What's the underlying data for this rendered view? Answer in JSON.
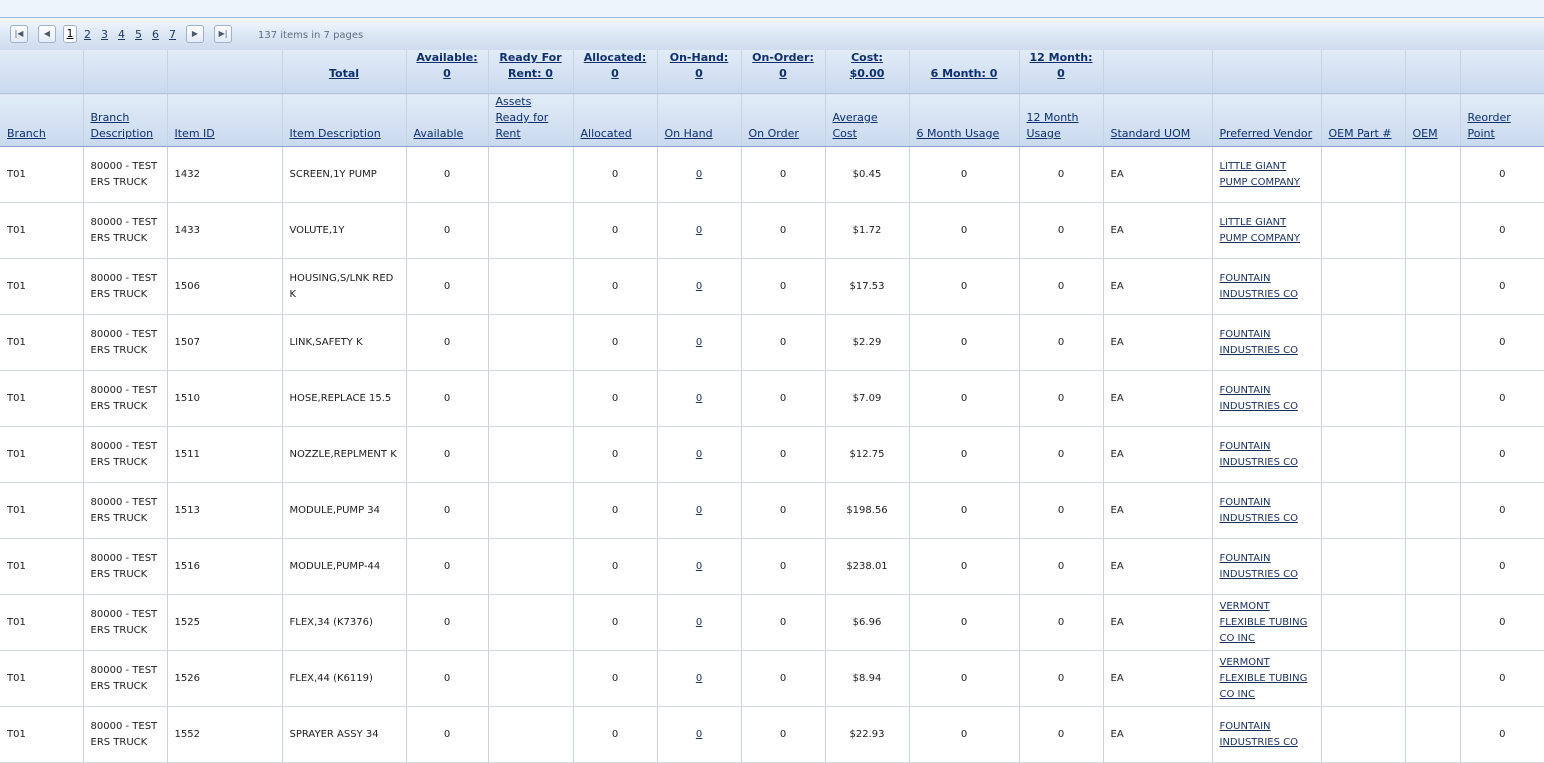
{
  "pager": {
    "first_icon": "first-page-icon",
    "prev_icon": "prev-page-icon",
    "next_icon": "next-page-icon",
    "last_icon": "last-page-icon",
    "pages": [
      "1",
      "2",
      "3",
      "4",
      "5",
      "6",
      "7"
    ],
    "current_page": "1",
    "info": "137 items in 7 pages"
  },
  "aggregates": {
    "total": "Total",
    "available": "Available: 0",
    "ready_for_rent": "Ready For Rent: 0",
    "allocated": "Allocated: 0",
    "on_hand": "On-Hand: 0",
    "on_order": "On-Order: 0",
    "cost": "Cost: $0.00",
    "six_month": "6 Month: 0",
    "twelve_month": "12 Month: 0"
  },
  "columns": {
    "branch": "Branch",
    "branch_description": "Branch Description",
    "item_id": "Item ID",
    "item_description": "Item Description",
    "available": "Available",
    "assets_ready": "Assets Ready for Rent",
    "allocated": "Allocated",
    "on_hand": "On Hand",
    "on_order": "On Order",
    "average_cost": "Average Cost",
    "six_month_usage": "6 Month Usage",
    "twelve_month_usage": "12 Month Usage",
    "standard_uom": "Standard UOM",
    "preferred_vendor": "Preferred Vendor",
    "oem_part": "OEM Part #",
    "oem": "OEM",
    "reorder_point": "Reorder Point"
  },
  "rows": [
    {
      "branch": "T01",
      "branch_desc": "80000 - TEST ERS TRUCK",
      "item_id": "1432",
      "desc": "SCREEN,1Y PUMP",
      "available": "0",
      "ready": "",
      "allocated": "0",
      "on_hand": "0",
      "on_order": "0",
      "avg_cost": "$0.45",
      "six": "0",
      "twelve": "0",
      "uom": "EA",
      "vendor": "LITTLE GIANT PUMP COMPANY",
      "oem_part": "",
      "oem": "",
      "reorder": "0"
    },
    {
      "branch": "T01",
      "branch_desc": "80000 - TEST ERS TRUCK",
      "item_id": "1433",
      "desc": "VOLUTE,1Y",
      "available": "0",
      "ready": "",
      "allocated": "0",
      "on_hand": "0",
      "on_order": "0",
      "avg_cost": "$1.72",
      "six": "0",
      "twelve": "0",
      "uom": "EA",
      "vendor": "LITTLE GIANT PUMP COMPANY",
      "oem_part": "",
      "oem": "",
      "reorder": "0"
    },
    {
      "branch": "T01",
      "branch_desc": "80000 - TEST ERS TRUCK",
      "item_id": "1506",
      "desc": "HOUSING,S/LNK RED K",
      "available": "0",
      "ready": "",
      "allocated": "0",
      "on_hand": "0",
      "on_order": "0",
      "avg_cost": "$17.53",
      "six": "0",
      "twelve": "0",
      "uom": "EA",
      "vendor": "FOUNTAIN INDUSTRIES CO",
      "oem_part": "",
      "oem": "",
      "reorder": "0"
    },
    {
      "branch": "T01",
      "branch_desc": "80000 - TEST ERS TRUCK",
      "item_id": "1507",
      "desc": "LINK,SAFETY K",
      "available": "0",
      "ready": "",
      "allocated": "0",
      "on_hand": "0",
      "on_order": "0",
      "avg_cost": "$2.29",
      "six": "0",
      "twelve": "0",
      "uom": "EA",
      "vendor": "FOUNTAIN INDUSTRIES CO",
      "oem_part": "",
      "oem": "",
      "reorder": "0"
    },
    {
      "branch": "T01",
      "branch_desc": "80000 - TEST ERS TRUCK",
      "item_id": "1510",
      "desc": "HOSE,REPLACE 15.5",
      "available": "0",
      "ready": "",
      "allocated": "0",
      "on_hand": "0",
      "on_order": "0",
      "avg_cost": "$7.09",
      "six": "0",
      "twelve": "0",
      "uom": "EA",
      "vendor": "FOUNTAIN INDUSTRIES CO",
      "oem_part": "",
      "oem": "",
      "reorder": "0"
    },
    {
      "branch": "T01",
      "branch_desc": "80000 - TEST ERS TRUCK",
      "item_id": "1511",
      "desc": "NOZZLE,REPLMENT K",
      "available": "0",
      "ready": "",
      "allocated": "0",
      "on_hand": "0",
      "on_order": "0",
      "avg_cost": "$12.75",
      "six": "0",
      "twelve": "0",
      "uom": "EA",
      "vendor": "FOUNTAIN INDUSTRIES CO",
      "oem_part": "",
      "oem": "",
      "reorder": "0"
    },
    {
      "branch": "T01",
      "branch_desc": "80000 - TEST ERS TRUCK",
      "item_id": "1513",
      "desc": "MODULE,PUMP 34",
      "available": "0",
      "ready": "",
      "allocated": "0",
      "on_hand": "0",
      "on_order": "0",
      "avg_cost": "$198.56",
      "six": "0",
      "twelve": "0",
      "uom": "EA",
      "vendor": "FOUNTAIN INDUSTRIES CO",
      "oem_part": "",
      "oem": "",
      "reorder": "0"
    },
    {
      "branch": "T01",
      "branch_desc": "80000 - TEST ERS TRUCK",
      "item_id": "1516",
      "desc": "MODULE,PUMP-44",
      "available": "0",
      "ready": "",
      "allocated": "0",
      "on_hand": "0",
      "on_order": "0",
      "avg_cost": "$238.01",
      "six": "0",
      "twelve": "0",
      "uom": "EA",
      "vendor": "FOUNTAIN INDUSTRIES CO",
      "oem_part": "",
      "oem": "",
      "reorder": "0"
    },
    {
      "branch": "T01",
      "branch_desc": "80000 - TEST ERS TRUCK",
      "item_id": "1525",
      "desc": "FLEX,34 (K7376)",
      "available": "0",
      "ready": "",
      "allocated": "0",
      "on_hand": "0",
      "on_order": "0",
      "avg_cost": "$6.96",
      "six": "0",
      "twelve": "0",
      "uom": "EA",
      "vendor": "VERMONT FLEXIBLE TUBING CO INC",
      "oem_part": "",
      "oem": "",
      "reorder": "0"
    },
    {
      "branch": "T01",
      "branch_desc": "80000 - TEST ERS TRUCK",
      "item_id": "1526",
      "desc": "FLEX,44 (K6119)",
      "available": "0",
      "ready": "",
      "allocated": "0",
      "on_hand": "0",
      "on_order": "0",
      "avg_cost": "$8.94",
      "six": "0",
      "twelve": "0",
      "uom": "EA",
      "vendor": "VERMONT FLEXIBLE TUBING CO INC",
      "oem_part": "",
      "oem": "",
      "reorder": "0"
    },
    {
      "branch": "T01",
      "branch_desc": "80000 - TEST ERS TRUCK",
      "item_id": "1552",
      "desc": "SPRAYER ASSY 34",
      "available": "0",
      "ready": "",
      "allocated": "0",
      "on_hand": "0",
      "on_order": "0",
      "avg_cost": "$22.93",
      "six": "0",
      "twelve": "0",
      "uom": "EA",
      "vendor": "FOUNTAIN INDUSTRIES CO",
      "oem_part": "",
      "oem": "",
      "reorder": "0"
    }
  ]
}
